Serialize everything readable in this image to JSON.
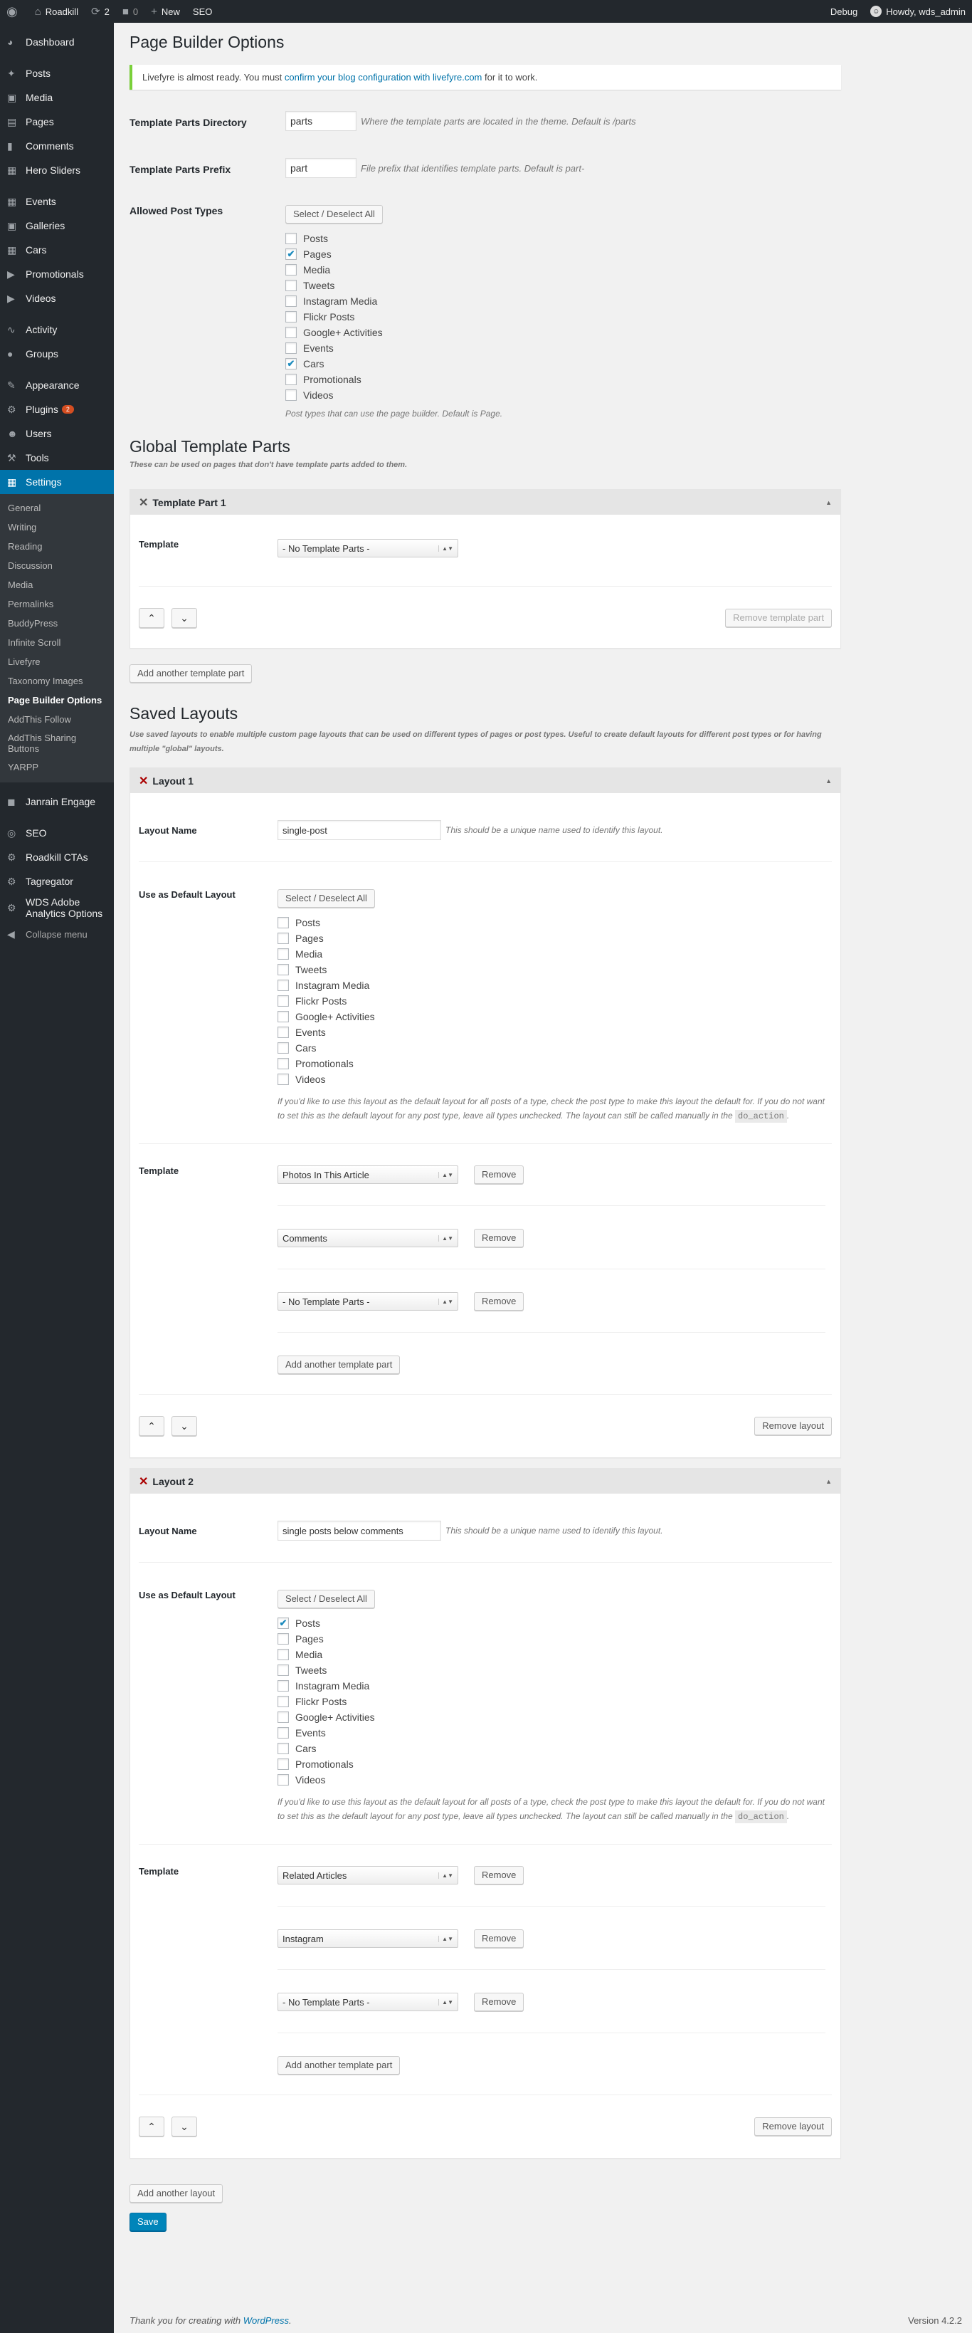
{
  "adminbar": {
    "site": "Roadkill",
    "updates": "2",
    "comments": "0",
    "new": "New",
    "seo": "SEO",
    "debug": "Debug",
    "howdy": "Howdy, wds_admin"
  },
  "menu": {
    "group1": [
      "Dashboard"
    ],
    "group2": [
      "Posts",
      "Media",
      "Pages",
      "Comments",
      "Hero Sliders"
    ],
    "group3": [
      "Events",
      "Galleries",
      "Cars",
      "Promotionals",
      "Videos"
    ],
    "group4": [
      "Activity",
      "Groups"
    ],
    "group5": [
      "Appearance",
      "Plugins",
      "Users",
      "Tools",
      "Settings"
    ],
    "plugins_badge": "2",
    "settings_sub": [
      "General",
      "Writing",
      "Reading",
      "Discussion",
      "Media",
      "Permalinks",
      "BuddyPress",
      "Infinite Scroll",
      "Livefyre",
      "Taxonomy Images",
      "Page Builder Options",
      "AddThis Follow",
      "AddThis Sharing Buttons",
      "YARPP"
    ],
    "group6": [
      "Janrain Engage"
    ],
    "group7": [
      "SEO",
      "Roadkill CTAs",
      "Tagregator",
      "WDS Adobe Analytics Options"
    ],
    "collapse": "Collapse menu"
  },
  "page": {
    "title": "Page Builder Options",
    "notice_pre": "Livefyre is almost ready. You must ",
    "notice_link": "confirm your blog configuration with livefyre.com",
    "notice_post": " for it to work.",
    "dir_label": "Template Parts Directory",
    "dir_value": "parts",
    "dir_desc": "Where the template parts are located in the theme. Default is /parts",
    "prefix_label": "Template Parts Prefix",
    "prefix_value": "part",
    "prefix_desc": "File prefix that identifies template parts. Default is part-",
    "allowed_label": "Allowed Post Types",
    "select_all": "Select / Deselect All",
    "allowed_desc": "Post types that can use the page builder. Default is Page.",
    "global_title": "Global Template Parts",
    "global_desc": "These can be used on pages that don't have template parts added to them.",
    "global_part_title": "Template Part 1",
    "template_label": "Template",
    "no_parts": "- No Template Parts -",
    "remove_template_part": "Remove template part",
    "add_template_part": "Add another template part",
    "saved_title": "Saved Layouts",
    "saved_desc": "Use saved layouts to enable multiple custom page layouts that can be used on different types of pages or post types. Useful to create default layouts for different post types or for having multiple \"global\" layouts.",
    "layout_name_label": "Layout Name",
    "layout_name_desc": "This should be a unique name used to identify this layout.",
    "default_label": "Use as Default Layout",
    "default_desc": "If you'd like to use this layout as the default layout for all posts of a type, check the post type to make this layout the default for. If you do not want to set this as the default layout for any post type, leave all types unchecked. The layout can still be called manually in the ",
    "default_code": "do_action",
    "default_end": ".",
    "remove": "Remove",
    "remove_layout": "Remove layout",
    "add_layout": "Add another layout",
    "save": "Save"
  },
  "post_types": [
    "Posts",
    "Pages",
    "Media",
    "Tweets",
    "Instagram Media",
    "Flickr Posts",
    "Google+ Activities",
    "Events",
    "Cars",
    "Promotionals",
    "Videos"
  ],
  "allowed_checked": [
    false,
    true,
    false,
    false,
    false,
    false,
    false,
    false,
    true,
    false,
    false
  ],
  "layouts": [
    {
      "title": "Layout 1",
      "name": "single-post",
      "checked": [
        false,
        false,
        false,
        false,
        false,
        false,
        false,
        false,
        false,
        false,
        false
      ],
      "templates": [
        "Photos In This Article",
        "Comments",
        "- No Template Parts -"
      ]
    },
    {
      "title": "Layout 2",
      "name": "single posts below comments",
      "checked": [
        true,
        false,
        false,
        false,
        false,
        false,
        false,
        false,
        false,
        false,
        false
      ],
      "templates": [
        "Related Articles",
        "Instagram",
        "- No Template Parts -"
      ]
    }
  ],
  "footer": {
    "thanks": "Thank you for creating with ",
    "wp": "WordPress",
    "end": ".",
    "version": "Version 4.2.2"
  },
  "icons": {
    "wp": "wordpress-icon",
    "home": "home-icon",
    "updates": "updates-icon",
    "comment": "comment-icon",
    "plus": "plus-icon"
  }
}
